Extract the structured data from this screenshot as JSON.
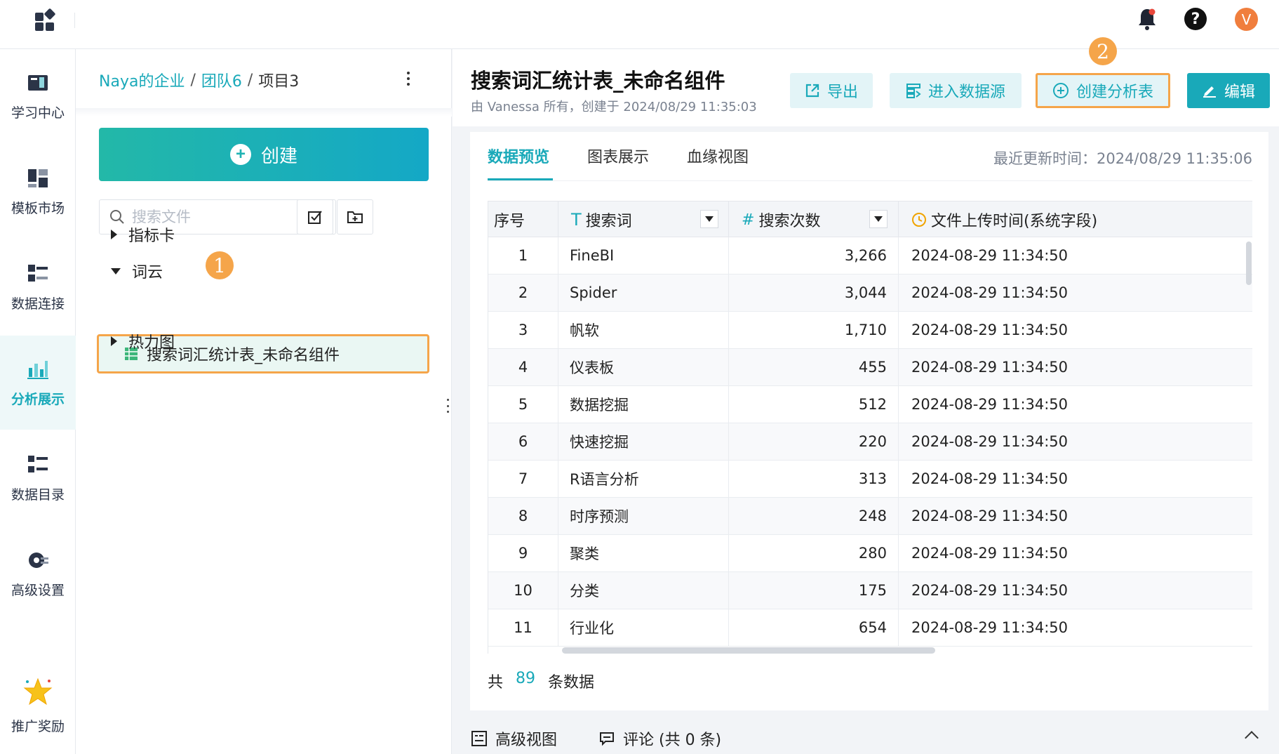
{
  "topbar": {
    "avatar_letter": "V",
    "help_symbol": "?"
  },
  "leftnav": {
    "items": [
      {
        "label": "学习中心",
        "icon": "book-icon"
      },
      {
        "label": "模板市场",
        "icon": "template-icon"
      },
      {
        "label": "数据连接",
        "icon": "database-link-icon"
      },
      {
        "label": "分析展示",
        "icon": "analysis-chart-icon",
        "active": true
      },
      {
        "label": "数据目录",
        "icon": "catalog-icon"
      },
      {
        "label": "高级设置",
        "icon": "gear-icon"
      },
      {
        "label": "推广奖励",
        "icon": "star-icon"
      }
    ]
  },
  "filepanel": {
    "breadcrumb": [
      "Naya的企业",
      "团队6",
      "项目3"
    ],
    "breadcrumb_sep": "/",
    "create_label": "创建",
    "search_placeholder": "搜索文件",
    "tree": [
      {
        "label": "指标卡",
        "expanded": false
      },
      {
        "label": "词云",
        "expanded": true
      },
      {
        "label": "热力图",
        "expanded": false
      }
    ],
    "selected_item": "搜索词汇统计表_未命名组件",
    "badge1": "1"
  },
  "header": {
    "title": "搜索词汇统计表_未命名组件",
    "subtitle": "由 Vanessa 所有，创建于 2024/08/29 11:35:03",
    "export_label": "导出",
    "datasource_label": "进入数据源",
    "create_analysis_label": "创建分析表",
    "edit_label": "编辑",
    "badge2": "2"
  },
  "tabs": [
    "数据预览",
    "图表展示",
    "血缘视图"
  ],
  "updated_text": "最近更新时间：2024/08/29 11:35:06",
  "table": {
    "columns": [
      {
        "label": "序号",
        "type_icon": ""
      },
      {
        "label": "搜索词",
        "type_icon": "T"
      },
      {
        "label": "搜索次数",
        "type_icon": "#"
      },
      {
        "label": "文件上传时间(系统字段)",
        "type_icon": "clock-icon"
      }
    ],
    "rows": [
      [
        "1",
        "FineBI",
        "3,266",
        "2024-08-29 11:34:50"
      ],
      [
        "2",
        "Spider",
        "3,044",
        "2024-08-29 11:34:50"
      ],
      [
        "3",
        "帆软",
        "1,710",
        "2024-08-29 11:34:50"
      ],
      [
        "4",
        "仪表板",
        "455",
        "2024-08-29 11:34:50"
      ],
      [
        "5",
        "数据挖掘",
        "512",
        "2024-08-29 11:34:50"
      ],
      [
        "6",
        "快速挖掘",
        "220",
        "2024-08-29 11:34:50"
      ],
      [
        "7",
        "R语言分析",
        "313",
        "2024-08-29 11:34:50"
      ],
      [
        "8",
        "时序预测",
        "248",
        "2024-08-29 11:34:50"
      ],
      [
        "9",
        "聚类",
        "280",
        "2024-08-29 11:34:50"
      ],
      [
        "10",
        "分类",
        "175",
        "2024-08-29 11:34:50"
      ],
      [
        "11",
        "行业化",
        "654",
        "2024-08-29 11:34:50"
      ]
    ]
  },
  "total": {
    "prefix": "共",
    "count": "89",
    "suffix": "条数据"
  },
  "bottombar": {
    "advanced_view_label": "高级视图",
    "comments_label": "评论 (共 0 条)"
  },
  "colors": {
    "accent": "#19a9b9",
    "highlight": "#f5a54a",
    "avatar": "#f07e3d"
  }
}
